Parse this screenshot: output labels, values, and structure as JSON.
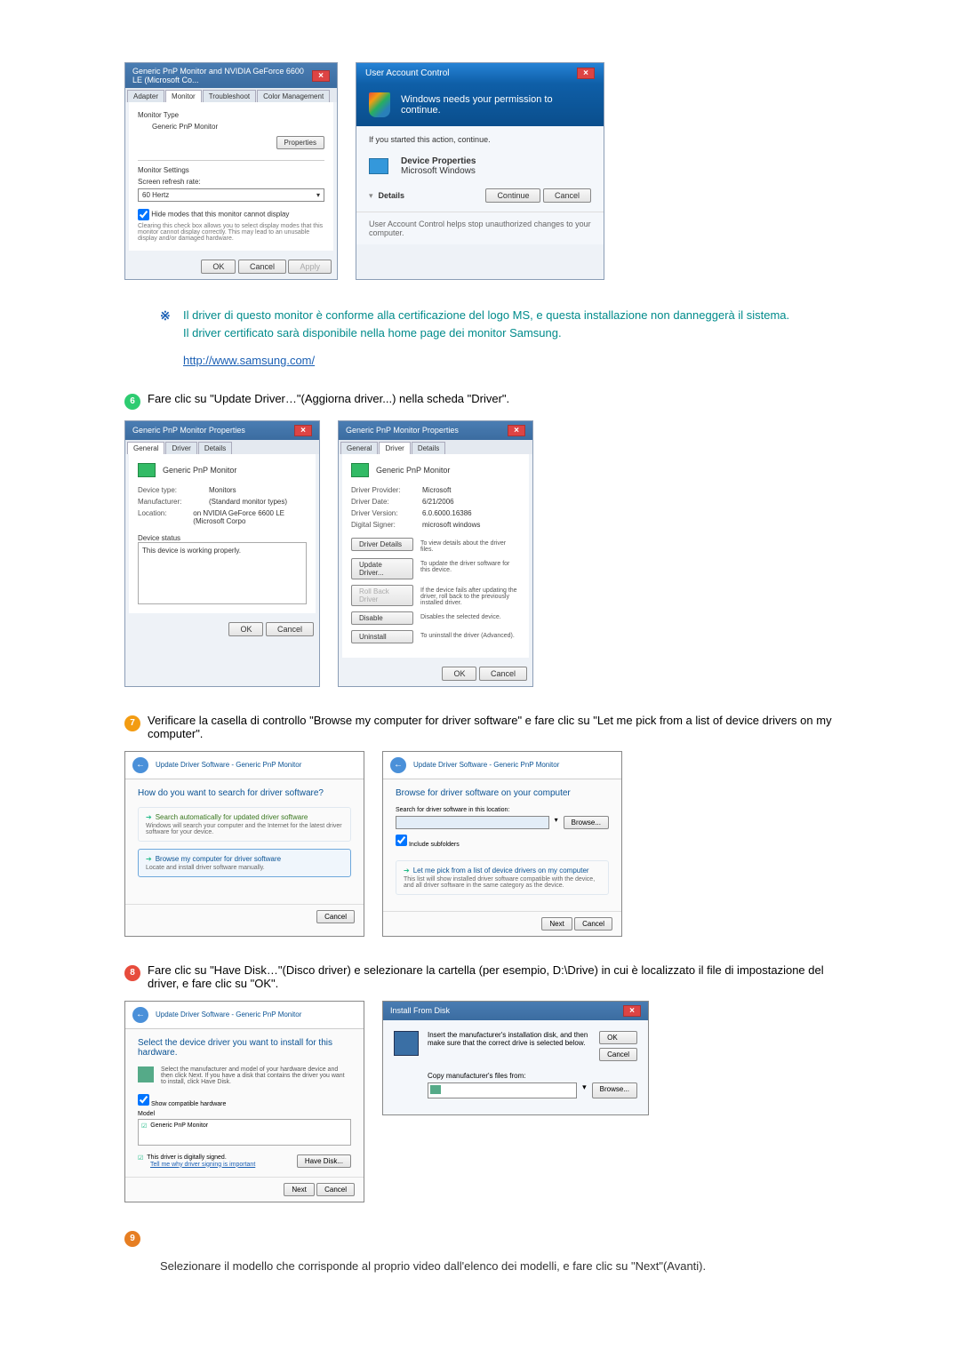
{
  "dialog1": {
    "title": "Generic PnP Monitor and NVIDIA GeForce 6600 LE (Microsoft Co...",
    "tabs": [
      "Adapter",
      "Monitor",
      "Troubleshoot",
      "Color Management"
    ],
    "monitor_type_label": "Monitor Type",
    "monitor_name": "Generic PnP Monitor",
    "properties_btn": "Properties",
    "monitor_settings_label": "Monitor Settings",
    "refresh_label": "Screen refresh rate:",
    "refresh_value": "60 Hertz",
    "hide_modes_label": "Hide modes that this monitor cannot display",
    "hide_modes_desc": "Clearing this check box allows you to select display modes that this monitor cannot display correctly. This may lead to an unusable display and/or damaged hardware.",
    "ok": "OK",
    "cancel": "Cancel",
    "apply": "Apply"
  },
  "uac": {
    "title": "User Account Control",
    "heading": "Windows needs your permission to continue.",
    "subheading": "If you started this action, continue.",
    "item1": "Device Properties",
    "item2": "Microsoft Windows",
    "details": "Details",
    "continue": "Continue",
    "cancel": "Cancel",
    "footer": "User Account Control helps stop unauthorized changes to your computer."
  },
  "note1": {
    "line1": "Il driver di questo monitor è conforme alla certificazione del logo MS, e questa installazione non danneggerà il sistema.",
    "line2": "Il driver certificato sarà disponibile nella home page dei monitor Samsung.",
    "link": "http://www.samsung.com/"
  },
  "step6": {
    "text": "Fare clic su \"Update Driver…\"(Aggiorna driver...) nella scheda \"Driver\"."
  },
  "propsGeneral": {
    "title": "Generic PnP Monitor Properties",
    "tabs": [
      "General",
      "Driver",
      "Details"
    ],
    "name": "Generic PnP Monitor",
    "rows": {
      "device_type_l": "Device type:",
      "device_type_v": "Monitors",
      "manufacturer_l": "Manufacturer:",
      "manufacturer_v": "(Standard monitor types)",
      "location_l": "Location:",
      "location_v": "on NVIDIA GeForce 6600 LE (Microsoft Corpo",
      "status_l": "Device status",
      "status_v": "This device is working properly."
    },
    "ok": "OK",
    "cancel": "Cancel"
  },
  "propsDriver": {
    "title": "Generic PnP Monitor Properties",
    "tabs": [
      "General",
      "Driver",
      "Details"
    ],
    "name": "Generic PnP Monitor",
    "rows": {
      "provider_l": "Driver Provider:",
      "provider_v": "Microsoft",
      "date_l": "Driver Date:",
      "date_v": "6/21/2006",
      "version_l": "Driver Version:",
      "version_v": "6.0.6000.16386",
      "signer_l": "Digital Signer:",
      "signer_v": "microsoft windows"
    },
    "btns": {
      "details_l": "Driver Details",
      "details_d": "To view details about the driver files.",
      "update_l": "Update Driver...",
      "update_d": "To update the driver software for this device.",
      "rollback_l": "Roll Back Driver",
      "rollback_d": "If the device fails after updating the driver, roll back to the previously installed driver.",
      "disable_l": "Disable",
      "disable_d": "Disables the selected device.",
      "uninstall_l": "Uninstall",
      "uninstall_d": "To uninstall the driver (Advanced)."
    },
    "ok": "OK",
    "cancel": "Cancel"
  },
  "step7": {
    "text": "Verificare la casella di controllo \"Browse my computer for driver software\" e fare clic su \"Let me pick from a list of device drivers on my computer\"."
  },
  "wizardSearch": {
    "breadcrumb": "Update Driver Software - Generic PnP Monitor",
    "heading": "How do you want to search for driver software?",
    "opt1_title": "Search automatically for updated driver software",
    "opt1_desc": "Windows will search your computer and the Internet for the latest driver software for your device.",
    "opt2_title": "Browse my computer for driver software",
    "opt2_desc": "Locate and install driver software manually.",
    "cancel": "Cancel"
  },
  "wizardBrowse": {
    "breadcrumb": "Update Driver Software - Generic PnP Monitor",
    "heading": "Browse for driver software on your computer",
    "search_label": "Search for driver software in this location:",
    "browse": "Browse...",
    "include_label": "Include subfolders",
    "opt_title": "Let me pick from a list of device drivers on my computer",
    "opt_desc": "This list will show installed driver software compatible with the device, and all driver software in the same category as the device.",
    "next": "Next",
    "cancel": "Cancel"
  },
  "step8": {
    "text": "Fare clic su \"Have Disk…\"(Disco driver) e selezionare la cartella (per esempio, D:\\Drive) in cui è localizzato il file di impostazione del driver, e fare clic su \"OK\"."
  },
  "wizardSelect": {
    "breadcrumb": "Update Driver Software - Generic PnP Monitor",
    "heading": "Select the device driver you want to install for this hardware.",
    "desc": "Select the manufacturer and model of your hardware device and then click Next. If you have a disk that contains the driver you want to install, click Have Disk.",
    "compat_label": "Show compatible hardware",
    "model_label": "Model",
    "model_item": "Generic PnP Monitor",
    "signed_text": "This driver is digitally signed.",
    "signing_link": "Tell me why driver signing is important",
    "have_disk": "Have Disk...",
    "next": "Next",
    "cancel": "Cancel"
  },
  "installDisk": {
    "title": "Install From Disk",
    "desc": "Insert the manufacturer's installation disk, and then make sure that the correct drive is selected below.",
    "ok": "OK",
    "cancel": "Cancel",
    "copy_label": "Copy manufacturer's files from:",
    "browse": "Browse..."
  },
  "finalText": {
    "text": "Selezionare il modello che corrisponde al proprio video dall'elenco dei modelli, e fare clic su \"Next\"(Avanti)."
  }
}
